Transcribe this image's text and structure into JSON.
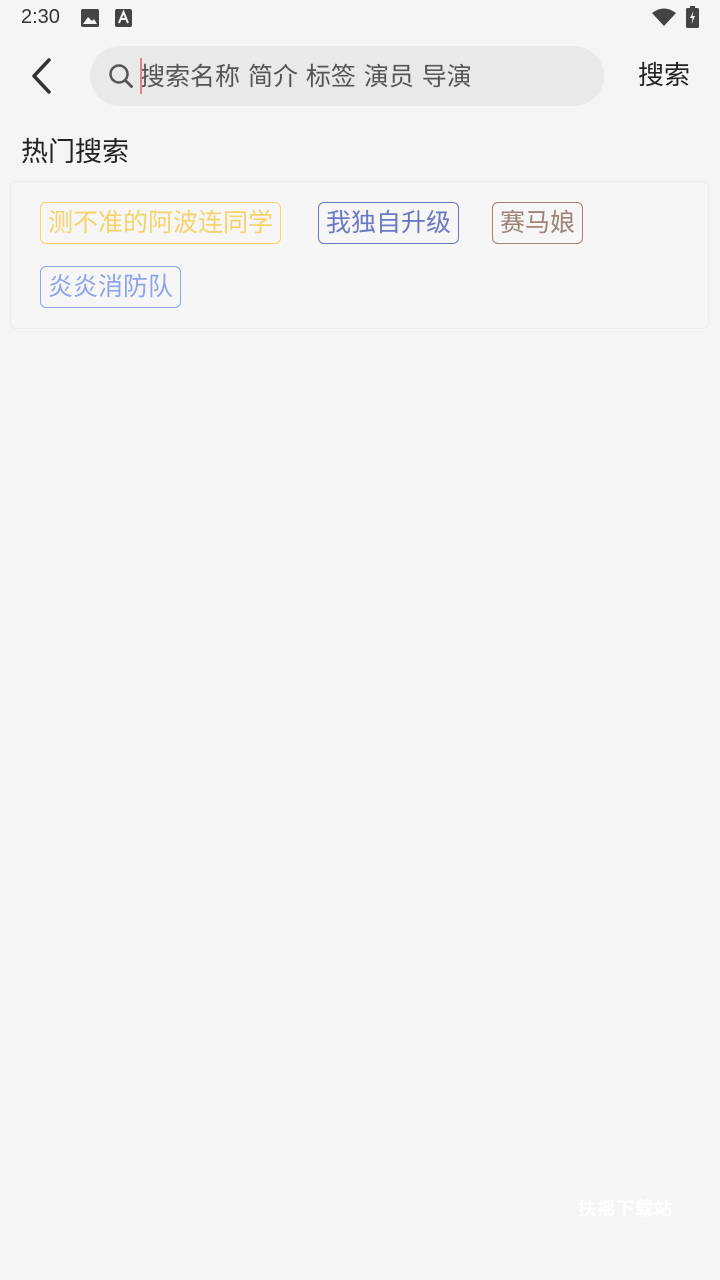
{
  "status_bar": {
    "time": "2:30",
    "icons": [
      "image-icon",
      "keyboard-a-icon",
      "wifi-icon",
      "battery-charging-icon"
    ]
  },
  "search": {
    "placeholder": "搜索名称 简介 标签 演员 导演",
    "value": "",
    "button_label": "搜索"
  },
  "hot_search": {
    "title": "热门搜索",
    "tags": [
      {
        "label": "测不准的阿波连同学",
        "color": "#f5d36a"
      },
      {
        "label": "我独自升级",
        "color": "#6b78c4"
      },
      {
        "label": "赛马娘",
        "color": "#a08378"
      },
      {
        "label": "炎炎消防队",
        "color": "#8ea4ec"
      }
    ]
  },
  "watermark": "扶摇下载站"
}
